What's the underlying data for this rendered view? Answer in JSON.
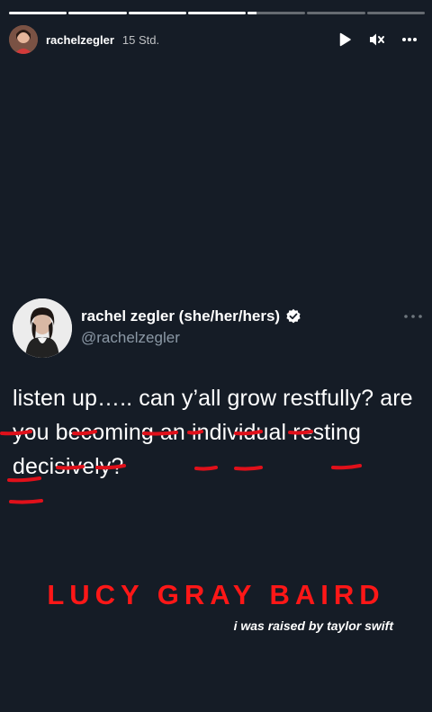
{
  "story": {
    "segments": [
      1,
      1,
      1,
      1,
      0.15,
      0,
      0
    ],
    "username": "rachelzegler",
    "timestamp": "15 Std."
  },
  "controls": {
    "play_icon": "play-icon",
    "mute_icon": "muted-speaker-icon",
    "more_icon": "more-horizontal-icon"
  },
  "tweet": {
    "display_name": "rachel zegler (she/her/hers)",
    "handle": "@rachelzegler",
    "verified": true,
    "text": "listen up….. can y’all grow restfully? are you becoming an individual resting decisively?",
    "underline_color": "#e0101a"
  },
  "caption": {
    "title": "LUCY GRAY BAIRD",
    "subtitle": "i was raised by taylor swift",
    "title_color": "#ff1717"
  }
}
